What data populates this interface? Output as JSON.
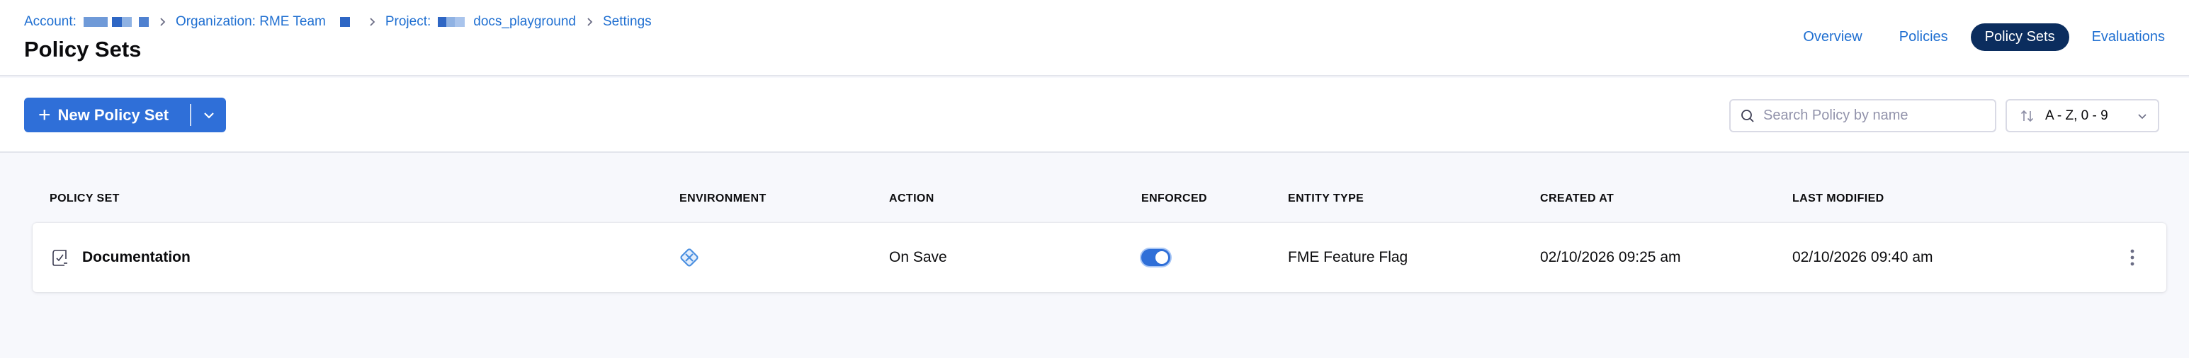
{
  "breadcrumb": {
    "account_label": "Account:",
    "org_label": "Organization: RME Team",
    "project_label": "Project:",
    "project_name": "docs_playground",
    "settings_label": "Settings"
  },
  "page_title": "Policy Sets",
  "tabs": [
    {
      "label": "Overview",
      "active": false
    },
    {
      "label": "Policies",
      "active": false
    },
    {
      "label": "Policy Sets",
      "active": true
    },
    {
      "label": "Evaluations",
      "active": false
    }
  ],
  "toolbar": {
    "new_button_label": "New Policy Set",
    "search_placeholder": "Search Policy by name",
    "search_value": "",
    "sort_label": "A - Z, 0 - 9"
  },
  "table": {
    "columns": [
      "POLICY SET",
      "ENVIRONMENT",
      "ACTION",
      "ENFORCED",
      "ENTITY TYPE",
      "CREATED AT",
      "LAST MODIFIED"
    ],
    "rows": [
      {
        "name": "Documentation",
        "environment_icon": "environment-icon",
        "action": "On Save",
        "enforced": true,
        "entity_type": "FME Feature Flag",
        "created_at": "02/10/2026 09:25 am",
        "last_modified": "02/10/2026 09:40 am"
      }
    ]
  },
  "colors": {
    "accent": "#2f6fd8",
    "link": "#1f6fd1",
    "active_tab_bg": "#0b2d5e",
    "page_bg": "#f7f8fc"
  }
}
